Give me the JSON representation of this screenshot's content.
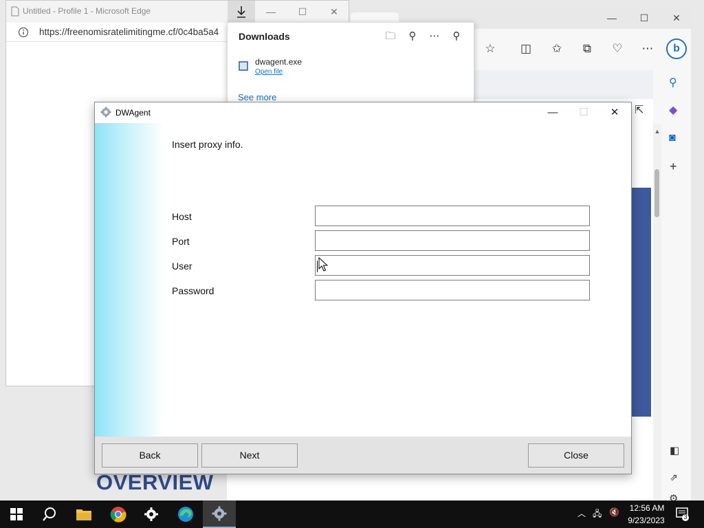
{
  "edge_back": {
    "close_symbol": "✕",
    "maximize_symbol": "☐",
    "minimize_symbol": "—",
    "page_heading": "OVERVIEW"
  },
  "edge_front": {
    "title": "Untitled - Profile 1 - Microsoft Edge",
    "url": "https://freenomisratelimitingme.cf/0c4ba5a4"
  },
  "downloads": {
    "title": "Downloads",
    "file_name": "dwagent.exe",
    "open_file": "Open file",
    "see_more": "See more"
  },
  "dwagent": {
    "title": "DWAgent",
    "heading": "Insert proxy info.",
    "fields": [
      {
        "label": "Host",
        "value": ""
      },
      {
        "label": "Port",
        "value": ""
      },
      {
        "label": "User",
        "value": ""
      },
      {
        "label": "Password",
        "value": ""
      }
    ],
    "buttons": {
      "back": "Back",
      "next": "Next",
      "close": "Close"
    }
  },
  "taskbar": {
    "time": "12:56 AM",
    "date": "9/23/2023",
    "notification_count": "3"
  },
  "colors": {
    "accent_blue": "#3e5a9c",
    "link_blue": "#1a6dbf",
    "sidebar_gradient_start": "#8fe3f7"
  }
}
